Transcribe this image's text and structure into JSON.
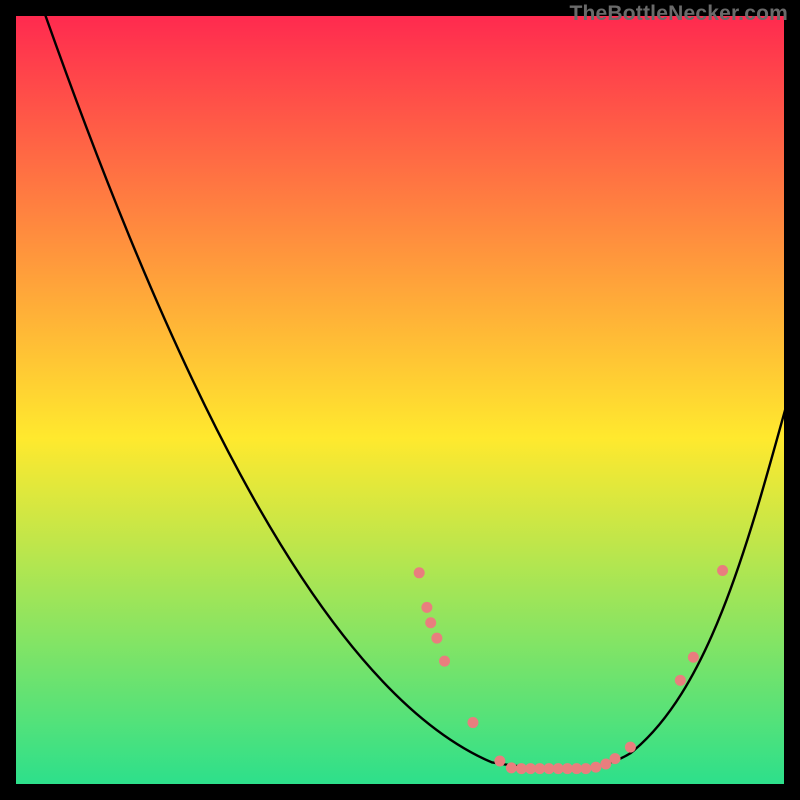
{
  "watermark": "TheBottleNecker.com",
  "chart_data": {
    "type": "line",
    "title": "",
    "xlabel": "",
    "ylabel": "",
    "xlim": [
      0,
      100
    ],
    "ylim": [
      0,
      100
    ],
    "grid": false,
    "background_gradient": {
      "top": "#ff2a4f",
      "mid": "#ffe92e",
      "bottom": "#2de08b"
    },
    "curve": {
      "segments": [
        {
          "type": "M",
          "x": 3.5,
          "y": 101
        },
        {
          "type": "C",
          "x1": 18,
          "y1": 60,
          "x2": 38,
          "y2": 13,
          "x": 62,
          "y": 2.8
        },
        {
          "type": "C",
          "x1": 70,
          "y1": 1.5,
          "x2": 76,
          "y2": 1.5,
          "x": 80,
          "y": 4
        },
        {
          "type": "C",
          "x1": 90,
          "y1": 12,
          "x2": 95,
          "y2": 30,
          "x": 100.5,
          "y": 50
        }
      ],
      "stroke": "#000000",
      "stroke_width": 2.4
    },
    "points": {
      "color": "#e97e7e",
      "radius": 5.5,
      "xy": [
        [
          52.5,
          27.5
        ],
        [
          53.5,
          23.0
        ],
        [
          54.0,
          21.0
        ],
        [
          54.8,
          19.0
        ],
        [
          55.8,
          16.0
        ],
        [
          59.5,
          8.0
        ],
        [
          63.0,
          3.0
        ],
        [
          64.5,
          2.1
        ],
        [
          65.8,
          2.0
        ],
        [
          67.0,
          2.0
        ],
        [
          68.2,
          2.0
        ],
        [
          69.4,
          2.0
        ],
        [
          70.6,
          2.0
        ],
        [
          71.8,
          2.0
        ],
        [
          73.0,
          2.0
        ],
        [
          74.2,
          2.0
        ],
        [
          75.5,
          2.2
        ],
        [
          76.8,
          2.6
        ],
        [
          78.0,
          3.3
        ],
        [
          80.0,
          4.8
        ],
        [
          86.5,
          13.5
        ],
        [
          88.2,
          16.5
        ],
        [
          92.0,
          27.8
        ]
      ]
    }
  }
}
